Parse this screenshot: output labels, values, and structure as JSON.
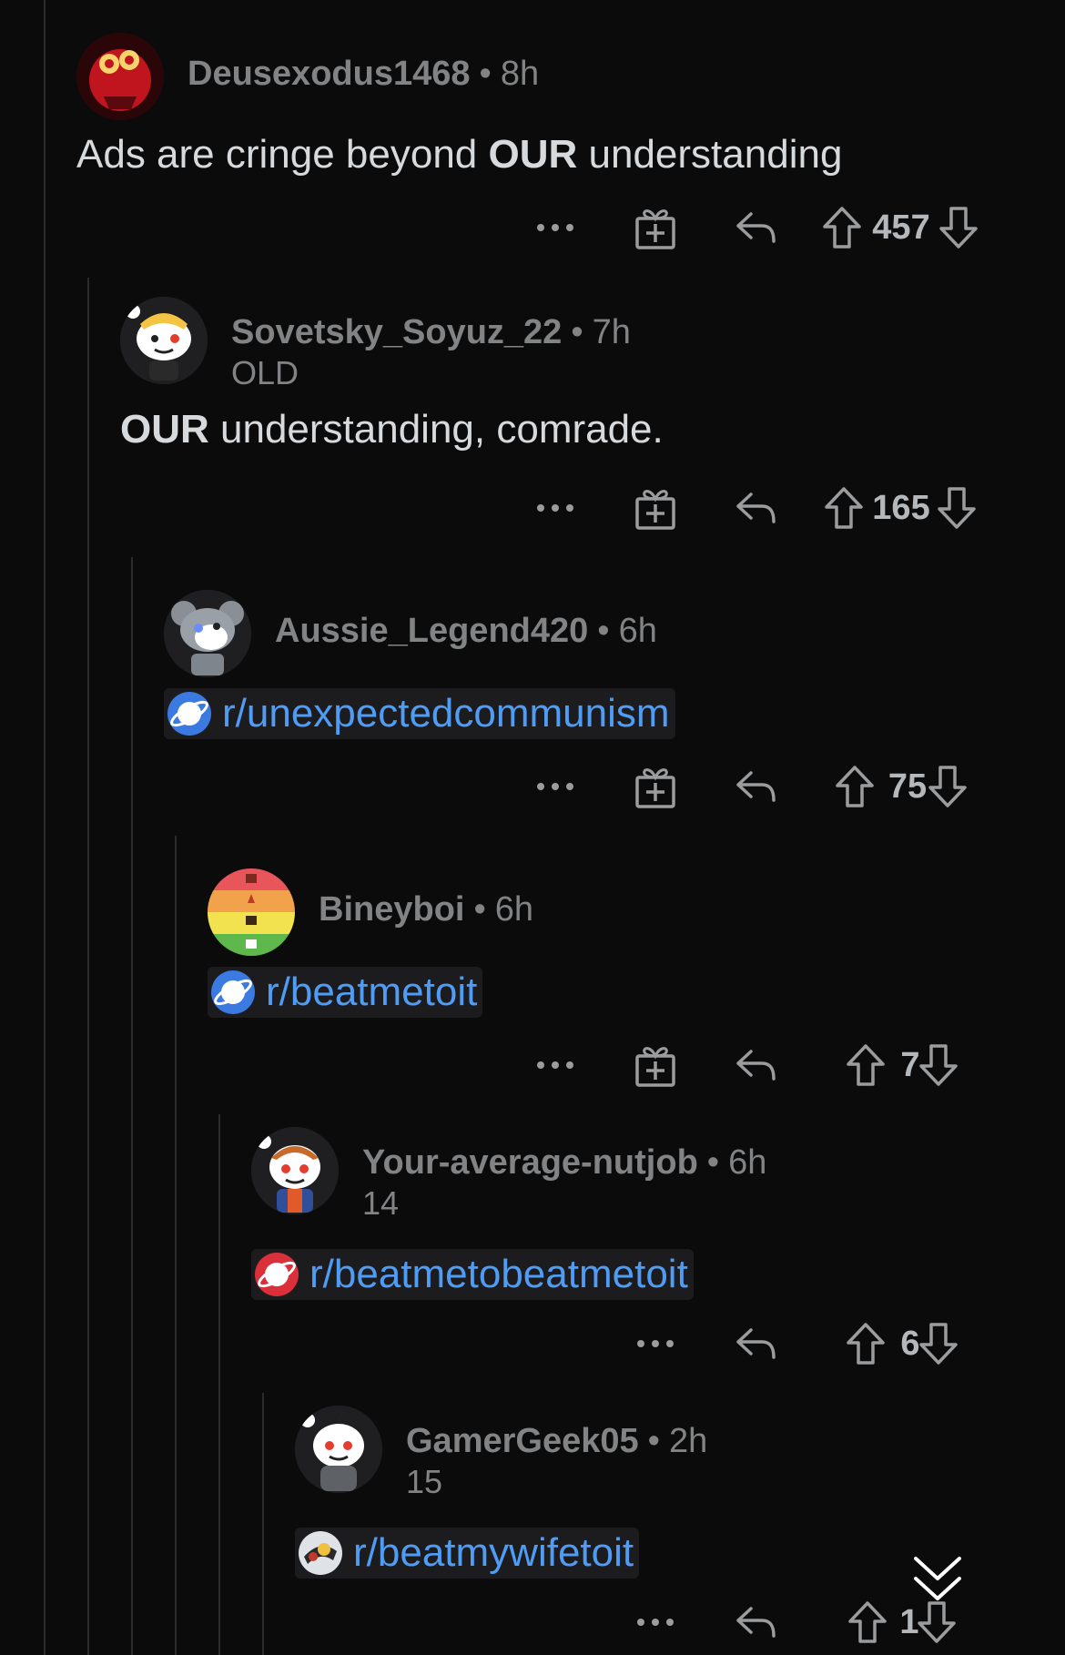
{
  "comments": [
    {
      "username": "Deusexodus1468",
      "time": "8h",
      "flair": "",
      "body_plain_1": "Ads are cringe beyond ",
      "body_bold": "OUR",
      "body_plain_2": " understanding",
      "votes": "457",
      "avatar": "red-robot-avatar"
    },
    {
      "username": "Sovetsky_Soyuz_22",
      "time": "7h",
      "flair": "OLD",
      "body_bold": "OUR",
      "body_plain_2": " understanding, comrade.",
      "votes": "165",
      "avatar": "snoo-blonde-avatar"
    },
    {
      "username": "Aussie_Legend420",
      "time": "6h",
      "flair": "",
      "subreddit": "r/unexpectedcommunism",
      "votes": "75",
      "avatar": "koala-snoo-avatar"
    },
    {
      "username": "Bineyboi",
      "time": "6h",
      "flair": "",
      "subreddit": "r/beatmetoit",
      "votes": "7",
      "avatar": "rainbow-flag-avatar"
    },
    {
      "username": "Your-average-nutjob",
      "time": "6h",
      "flair": "14",
      "subreddit": "r/beatmetobeatmetoit",
      "votes": "6",
      "avatar": "snoo-orange-hair-avatar"
    },
    {
      "username": "GamerGeek05",
      "time": "2h",
      "flair": "15",
      "subreddit": "r/beatmywifetoit",
      "votes": "1",
      "avatar": "snoo-grey-hoodie-avatar"
    }
  ],
  "colors": {
    "background": "#0b0b0c",
    "link": "#4f9cf5",
    "meta": "#818384",
    "text": "#d7dadc"
  }
}
